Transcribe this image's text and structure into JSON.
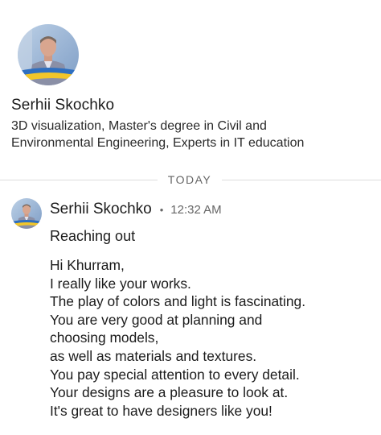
{
  "profile": {
    "name": "Serhii Skochko",
    "headline": "3D visualization, Master's degree in Civil and Environmental Engineering, Experts in IT education"
  },
  "divider": {
    "label": "TODAY"
  },
  "message": {
    "sender": "Serhii Skochko",
    "separator": "•",
    "time": "12:32 AM",
    "subject": "Reaching out",
    "body_lines": [
      "Hi Khurram,",
      "I really like your works.",
      "The play of colors and light is fascinating.",
      "You are very good at planning and",
      "choosing models,",
      "as well as materials and textures.",
      "You pay special attention to every detail.",
      "Your designs are a pleasure to look at.",
      "It's great to have designers like you!"
    ]
  },
  "colors": {
    "avatar_sky": "#9fb8d6",
    "avatar_shirt": "#8a8fa6",
    "avatar_skin": "#d9a68f",
    "avatar_flag_blue": "#2f6fc0",
    "avatar_flag_yellow": "#f2c62a",
    "divider": "#dcdcdc",
    "muted_text": "#666666"
  }
}
